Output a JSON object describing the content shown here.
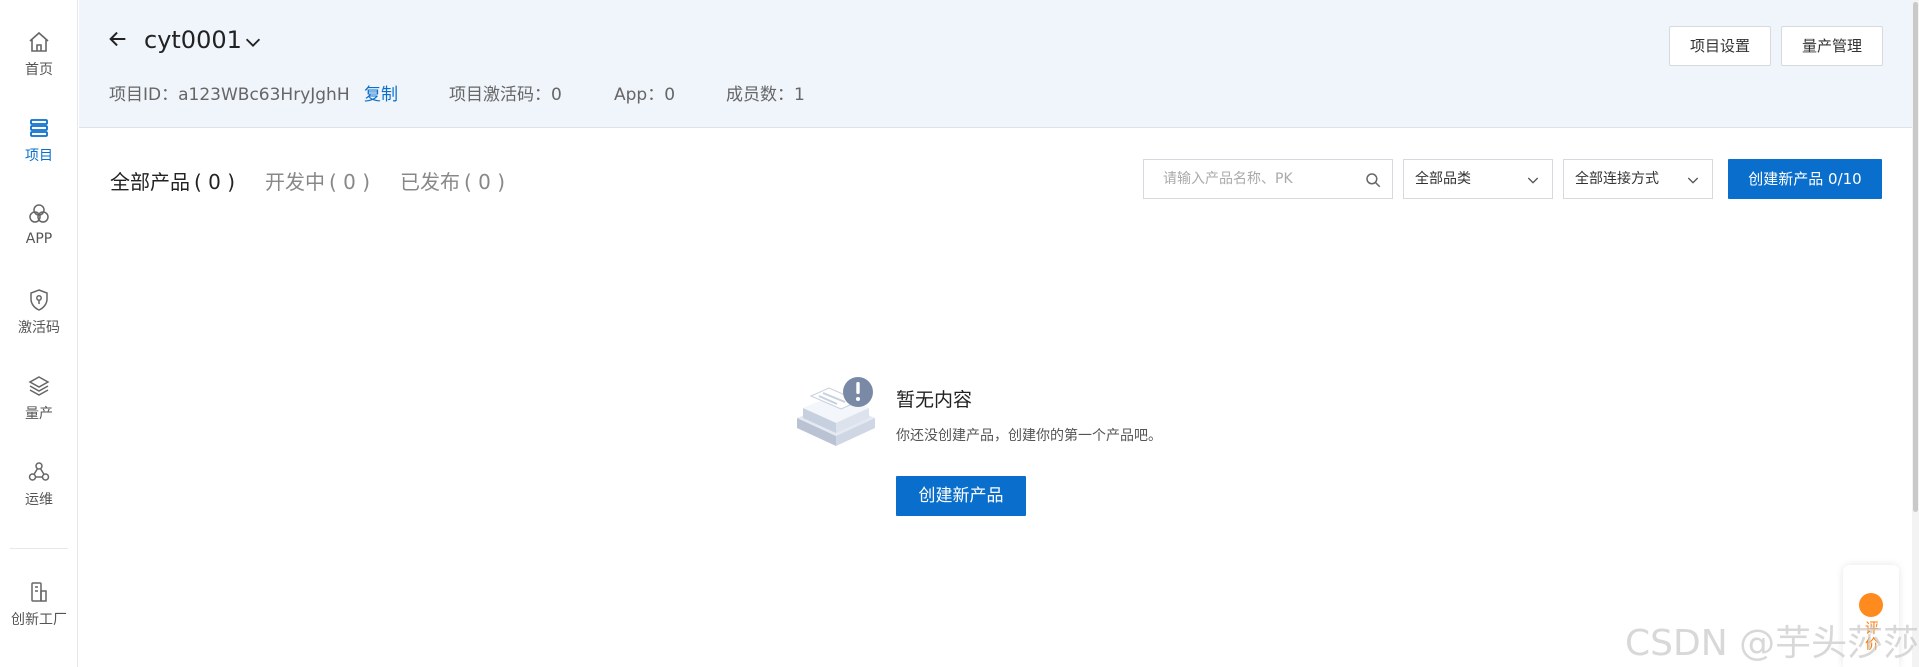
{
  "sidebar": {
    "items": [
      {
        "label": "首页",
        "icon": "home-icon"
      },
      {
        "label": "项目",
        "icon": "layers-list-icon",
        "active": true
      },
      {
        "label": "APP",
        "icon": "app-circles-icon"
      },
      {
        "label": "激活码",
        "icon": "shield-key-icon"
      },
      {
        "label": "量产",
        "icon": "stack-icon"
      },
      {
        "label": "运维",
        "icon": "nodes-icon"
      },
      {
        "label": "创新工厂",
        "icon": "factory-icon"
      }
    ]
  },
  "header": {
    "project_name": "cyt0001",
    "project_id_label": "项目ID：a123WBc63HryJghH",
    "copy_label": "复制",
    "activation_code_label": "项目激活码：0",
    "app_count_label": "App：0",
    "member_count_label": "成员数：1",
    "settings_button": "项目设置",
    "mass_production_button": "量产管理"
  },
  "tabs": [
    {
      "label": "全部产品",
      "count": "( 0 )",
      "active": true
    },
    {
      "label": "开发中",
      "count": "( 0 )"
    },
    {
      "label": "已发布",
      "count": "( 0 )"
    }
  ],
  "toolbar": {
    "search_placeholder": "请输入产品名称、PK",
    "category_select": "全部品类",
    "connection_select": "全部连接方式",
    "create_button": "创建新产品 0/10"
  },
  "empty_state": {
    "title": "暂无内容",
    "description": "你还没创建产品，创建你的第一个产品吧。",
    "button": "创建新产品"
  },
  "feedback": {
    "label": "评价"
  },
  "watermark": "CSDN @芋头莎莎",
  "colors": {
    "accent": "#0a6fcc",
    "header_bg": "#f0f4fb",
    "feedback_orange": "#ff8a1e"
  }
}
